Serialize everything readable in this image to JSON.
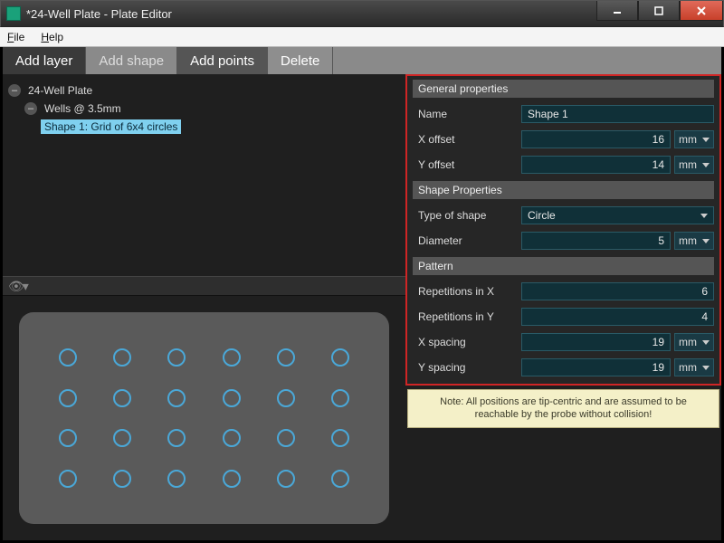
{
  "window": {
    "title": "*24-Well Plate - Plate Editor"
  },
  "menubar": {
    "file": "File",
    "help": "Help"
  },
  "toolbar": {
    "add_layer": "Add layer",
    "add_shape": "Add shape",
    "add_points": "Add points",
    "delete": "Delete"
  },
  "tree": {
    "root": "24-Well Plate",
    "layer": "Wells @ 3.5mm",
    "shape": "Shape 1: Grid of 6x4 circles"
  },
  "plate_grid": {
    "cols": 6,
    "rows": 4
  },
  "props": {
    "general": {
      "header": "General properties",
      "name_label": "Name",
      "name_value": "Shape 1",
      "xoff_label": "X offset",
      "xoff_value": "16",
      "xoff_unit": "mm",
      "yoff_label": "Y offset",
      "yoff_value": "14",
      "yoff_unit": "mm"
    },
    "shape": {
      "header": "Shape Properties",
      "type_label": "Type of shape",
      "type_value": "Circle",
      "diam_label": "Diameter",
      "diam_value": "5",
      "diam_unit": "mm"
    },
    "pattern": {
      "header": "Pattern",
      "rx_label": "Repetitions in X",
      "rx_value": "6",
      "ry_label": "Repetitions in Y",
      "ry_value": "4",
      "sx_label": "X spacing",
      "sx_value": "19",
      "sx_unit": "mm",
      "sy_label": "Y spacing",
      "sy_value": "19",
      "sy_unit": "mm"
    }
  },
  "note": "Note: All positions are tip-centric and are assumed to be reachable by the probe without collision!"
}
